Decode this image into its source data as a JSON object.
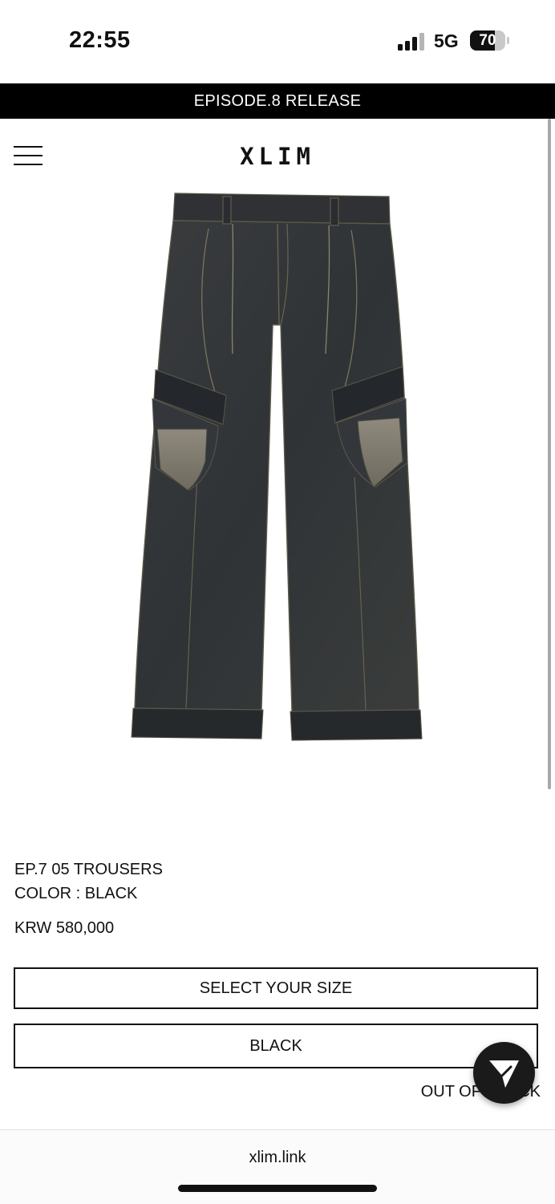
{
  "status_bar": {
    "time": "22:55",
    "network": "5G",
    "battery_level": "70"
  },
  "banner": {
    "text": "EPISODE.8 RELEASE"
  },
  "header": {
    "logo": "XLIM",
    "menu_icon": "hamburger-menu-icon"
  },
  "product": {
    "name": "EP.7 05 TROUSERS",
    "color_line": "COLOR : BLACK",
    "price": "KRW 580,000",
    "image": "black-denim-cargo-trousers"
  },
  "actions": {
    "size_select_label": "SELECT YOUR SIZE",
    "color_option_label": "BLACK",
    "stock_status": "OUT OF STOCK"
  },
  "chat": {
    "icon": "paper-plane-icon"
  },
  "browser": {
    "url": "xlim.link"
  },
  "colors": {
    "banner_bg": "#000000",
    "text": "#111111",
    "fab_bg": "#1a1a1a"
  }
}
